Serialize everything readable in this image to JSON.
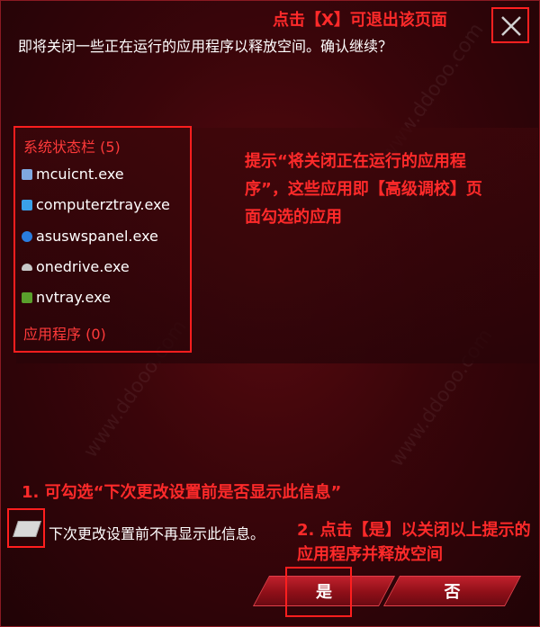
{
  "dialog": {
    "prompt": "即将关闭一些正在运行的应用程序以释放空间。确认继续？"
  },
  "groups": {
    "system_tray": "系统状态栏 (5)",
    "applications": "应用程序 (0)"
  },
  "processes": [
    {
      "name": "mcuicnt.exe",
      "icon": "mcu-app-icon",
      "color": "#7fa8e0"
    },
    {
      "name": "computerztray.exe",
      "icon": "computerz-app-icon",
      "color": "#3aa0e8"
    },
    {
      "name": "asuswspanel.exe",
      "icon": "asus-panel-icon",
      "color": "#2a7de0"
    },
    {
      "name": "onedrive.exe",
      "icon": "cloud-icon",
      "color": "#c8c8c8"
    },
    {
      "name": "nvtray.exe",
      "icon": "nvidia-icon",
      "color": "#5aa02c"
    }
  ],
  "checkbox": {
    "label": "下次更改设置前不再显示此信息。"
  },
  "buttons": {
    "yes": "是",
    "no": "否"
  },
  "annotations": {
    "close": "点击【X】可退出该页面",
    "hint": "提示“将关闭正在运行的应用程序”，这些应用即【高级调校】页面勾选的应用",
    "step1": "1. 可勾选“下次更改设置前是否显示此信息”",
    "step2": "2. 点击【是】以关闭以上提示的应用程序并释放空间"
  },
  "colors": {
    "accent_red": "#ff2a2a",
    "background": "#3a050a"
  }
}
